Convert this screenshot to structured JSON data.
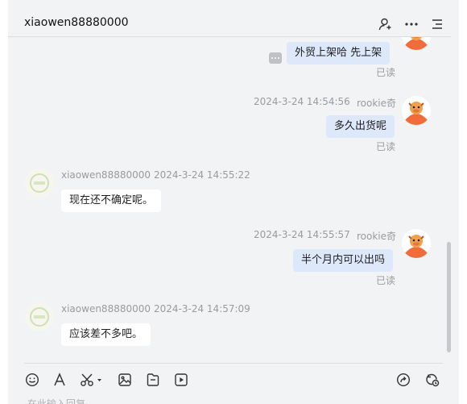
{
  "header": {
    "title": "xiaowen88880000",
    "icons": [
      "add-user-icon",
      "more-icon",
      "menu-icon"
    ]
  },
  "messages": [
    {
      "side": "out",
      "text": "外贸上架哈  先上架",
      "read": "已读"
    },
    {
      "side": "out",
      "time": "2024-3-24 14:54:56",
      "sender": "rookie奇",
      "text": "多久出货呢",
      "read": "已读"
    },
    {
      "side": "in",
      "sender": "xiaowen88880000",
      "time": "2024-3-24 14:55:22",
      "text": "现在还不确定呢。"
    },
    {
      "side": "out",
      "time": "2024-3-24 14:55:57",
      "sender": "rookie奇",
      "text": "半个月内可以出吗",
      "read": "已读"
    },
    {
      "side": "in",
      "sender": "xiaowen88880000",
      "time": "2024-3-24 14:57:09",
      "text": "应该差不多吧。"
    }
  ],
  "toolbar": {
    "icons": [
      "emoji-icon",
      "font-icon",
      "scissors-icon",
      "image-icon",
      "file-icon",
      "video-icon",
      "share-icon",
      "history-icon"
    ]
  },
  "composer": {
    "placeholder": "在此输入回复"
  },
  "colors": {
    "background": "#f2f3f5",
    "outgoing_bubble": "#dde8fb",
    "incoming_bubble": "#ffffff",
    "meta_text": "#9a9b9e"
  }
}
